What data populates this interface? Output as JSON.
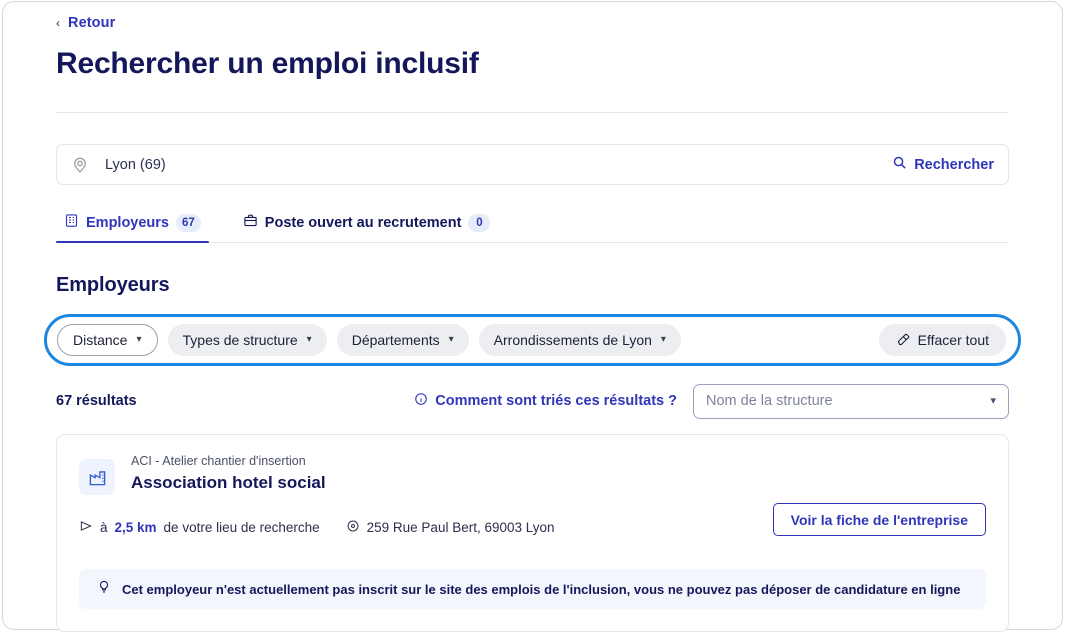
{
  "nav": {
    "back_label": "Retour",
    "back_icon": "chevron-left-icon"
  },
  "header": {
    "title": "Rechercher un emploi inclusif"
  },
  "search": {
    "location_icon": "map-pin-icon",
    "value": "Lyon (69)",
    "submit_label": "Rechercher",
    "submit_icon": "search-icon"
  },
  "tabs": [
    {
      "label": "Employeurs",
      "badge": "67",
      "icon": "building-icon",
      "active": true
    },
    {
      "label": "Poste ouvert au recrutement",
      "badge": "0",
      "icon": "briefcase-icon",
      "active": false
    }
  ],
  "section": {
    "heading": "Employeurs"
  },
  "filters": {
    "highlight_color": "#1c87e0",
    "chips": [
      {
        "label": "Distance",
        "style": "outlined"
      },
      {
        "label": "Types de structure",
        "style": "filled"
      },
      {
        "label": "Départements",
        "style": "filled"
      },
      {
        "label": "Arrondissements de Lyon",
        "style": "filled"
      }
    ],
    "clear_all_label": "Effacer tout",
    "clear_all_icon": "eraser-icon"
  },
  "results": {
    "count_label": "67 résultats",
    "sort_help_label": "Comment sont triés ces résultats ?",
    "sort_help_icon": "info-circle-icon",
    "sort_select_placeholder": "Nom de la structure",
    "sort_caret_icon": "chevron-down-icon"
  },
  "cards": [
    {
      "logo_icon": "factory-building-icon",
      "kind": "ACI - Atelier chantier d'insertion",
      "name": "Association hotel social",
      "distance_prefix": "à",
      "distance_value": "2,5 km",
      "distance_suffix": "de votre lieu de recherche",
      "distance_icon": "direction-arrow-icon",
      "address": "259 Rue Paul Bert, 69003 Lyon",
      "address_icon": "map-pin-icon",
      "cta_label": "Voir la fiche de l'entreprise",
      "notice_icon": "lightbulb-icon",
      "notice": "Cet employeur n'est actuellement pas inscrit sur le site des emplois de l'inclusion, vous ne pouvez pas déposer de candidature en ligne"
    }
  ],
  "colors": {
    "brand_blue": "#2f36b8",
    "navy": "#14185a",
    "highlight": "#1c87e0",
    "chip_bg": "#eceef1",
    "notice_bg": "#f3f6fd"
  }
}
